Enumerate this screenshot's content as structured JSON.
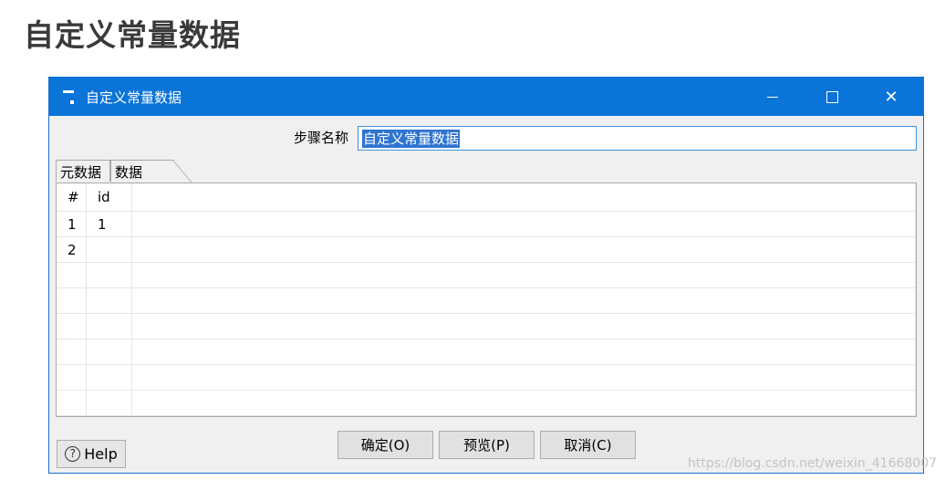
{
  "page": {
    "heading": "自定义常量数据"
  },
  "window": {
    "title": "自定义常量数据",
    "icon": "spoon-step-icon"
  },
  "form": {
    "step_name_label": "步骤名称",
    "step_name_value": "自定义常量数据"
  },
  "tabs": [
    {
      "label": "元数据",
      "active": false
    },
    {
      "label": "数据",
      "active": true
    }
  ],
  "grid": {
    "headers": [
      "#",
      "id",
      ""
    ],
    "rows": [
      [
        "1",
        "1",
        ""
      ],
      [
        "2",
        "",
        ""
      ],
      [
        "",
        "",
        ""
      ],
      [
        "",
        "",
        ""
      ],
      [
        "",
        "",
        ""
      ],
      [
        "",
        "",
        ""
      ],
      [
        "",
        "",
        ""
      ],
      [
        "",
        "",
        ""
      ]
    ]
  },
  "buttons": {
    "help": "Help",
    "help_icon_glyph": "?",
    "ok": "确定(O)",
    "preview": "预览(P)",
    "cancel": "取消(C)"
  },
  "watermark": "https://blog.csdn.net/weixin_41668007",
  "colors": {
    "titlebar": "#0a74d8",
    "selection": "#2f74d0"
  }
}
